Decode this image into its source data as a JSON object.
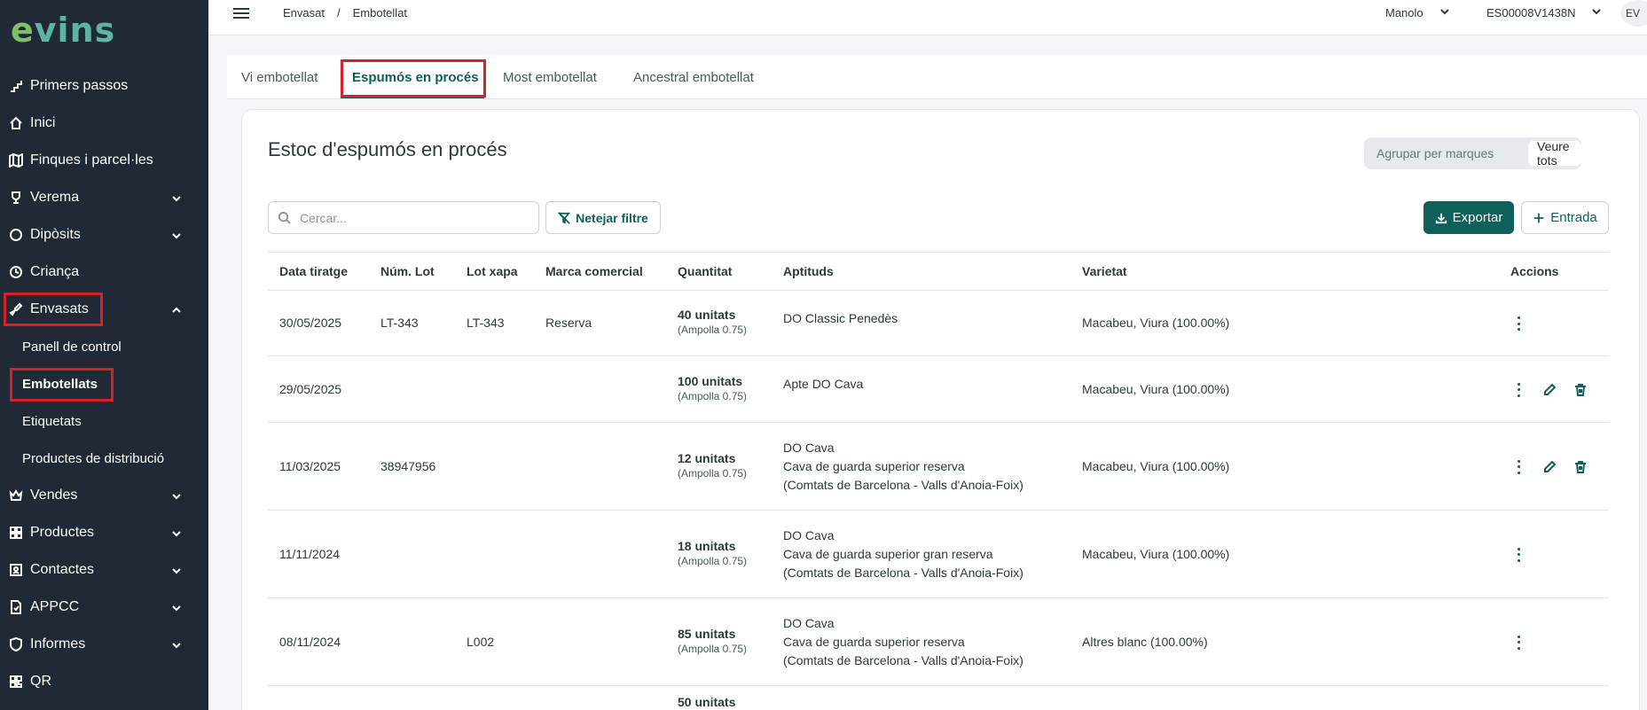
{
  "sidebar": {
    "logo": {
      "part1": "e",
      "part2": "vins"
    },
    "items": [
      {
        "label": "Primers passos",
        "icon": "stairs-icon",
        "chevron": false
      },
      {
        "label": "Inici",
        "icon": "home-icon",
        "chevron": false
      },
      {
        "label": "Finques i parcel·les",
        "icon": "map-icon",
        "chevron": false
      },
      {
        "label": "Verema",
        "icon": "trophy-icon",
        "chevron": true
      },
      {
        "label": "Dipòsits",
        "icon": "circle-icon",
        "chevron": true
      },
      {
        "label": "Criança",
        "icon": "clock-icon",
        "chevron": false
      },
      {
        "label": "Envasats",
        "icon": "bottle-icon",
        "chevron": true,
        "expanded": true
      }
    ],
    "subitems": [
      {
        "label": "Panell de control",
        "active": false
      },
      {
        "label": "Embotellats",
        "active": true
      },
      {
        "label": "Etiquetats",
        "active": false
      },
      {
        "label": "Productes de distribució",
        "active": false
      }
    ],
    "items_after": [
      {
        "label": "Vendes",
        "icon": "crown-icon",
        "chevron": true
      },
      {
        "label": "Productes",
        "icon": "grid-icon",
        "chevron": true
      },
      {
        "label": "Contactes",
        "icon": "contact-card-icon",
        "chevron": true
      },
      {
        "label": "APPCC",
        "icon": "document-icon",
        "chevron": true
      },
      {
        "label": "Informes",
        "icon": "shield-icon",
        "chevron": true
      },
      {
        "label": "QR",
        "icon": "qr-code-icon",
        "chevron": false
      }
    ]
  },
  "topbar": {
    "breadcrumb": [
      "Envasat",
      "Embotellat"
    ],
    "user": "Manolo",
    "registry": "ES00008V1438N",
    "avatar_initials": "EV"
  },
  "tabs": [
    {
      "label": "Vi embotellat",
      "active": false
    },
    {
      "label": "Espumós en procés",
      "active": true
    },
    {
      "label": "Most embotellat",
      "active": false
    },
    {
      "label": "Ancestral embotellat",
      "active": false
    }
  ],
  "card": {
    "title": "Estoc d'espumós en procés",
    "toggle": {
      "option_a": "Agrupar per marques",
      "option_b": "Veure tots",
      "selected": "option_b"
    },
    "search_placeholder": "Cercar...",
    "clear_filter_label": "Netejar filtre",
    "export_label": "Exportar",
    "entry_label": "Entrada"
  },
  "table": {
    "columns": [
      "Data tiratge",
      "Núm. Lot",
      "Lot xapa",
      "Marca comercial",
      "Quantitat",
      "Aptituds",
      "Varietat",
      "Accions"
    ],
    "rows": [
      {
        "data": "30/05/2025",
        "lot": "LT-343",
        "xapa": "LT-343",
        "marca": "Reserva",
        "qty": "40 unitats",
        "qty_sub": "(Ampolla 0.75)",
        "aptituds": [
          "DO Classic Penedès"
        ],
        "varietat": "Macabeu, Viura (100.00%)",
        "edit": false
      },
      {
        "data": "29/05/2025",
        "lot": "",
        "xapa": "",
        "marca": "",
        "qty": "100 unitats",
        "qty_sub": "(Ampolla 0.75)",
        "aptituds": [
          "Apte DO Cava"
        ],
        "varietat": "Macabeu, Viura (100.00%)",
        "edit": true
      },
      {
        "data": "11/03/2025",
        "lot": "38947956",
        "xapa": "",
        "marca": "",
        "qty": "12 unitats",
        "qty_sub": "(Ampolla 0.75)",
        "aptituds": [
          "DO Cava",
          "Cava de guarda superior reserva",
          "(Comtats de Barcelona - Valls d'Anoia-Foix)"
        ],
        "varietat": "Macabeu, Viura (100.00%)",
        "edit": true
      },
      {
        "data": "11/11/2024",
        "lot": "",
        "xapa": "",
        "marca": "",
        "qty": "18 unitats",
        "qty_sub": "(Ampolla 0.75)",
        "aptituds": [
          "DO Cava",
          "Cava de guarda superior gran reserva",
          "(Comtats de Barcelona - Valls d'Anoia-Foix)"
        ],
        "varietat": "Macabeu, Viura (100.00%)",
        "edit": false
      },
      {
        "data": "08/11/2024",
        "lot": "",
        "xapa": "L002",
        "marca": "",
        "qty": "85 unitats",
        "qty_sub": "(Ampolla 0.75)",
        "aptituds": [
          "DO Cava",
          "Cava de guarda superior reserva",
          "(Comtats de Barcelona - Valls d'Anoia-Foix)"
        ],
        "varietat": "Altres blanc (100.00%)",
        "edit": false
      },
      {
        "data": "",
        "lot": "",
        "xapa": "",
        "marca": "",
        "qty": "50 unitats",
        "qty_sub": "",
        "aptituds": [],
        "varietat": "",
        "edit": false
      }
    ]
  },
  "colors": {
    "sidebar_bg": "#1f2a36",
    "accent": "#0f5f5a",
    "highlight": "#d9202a"
  }
}
